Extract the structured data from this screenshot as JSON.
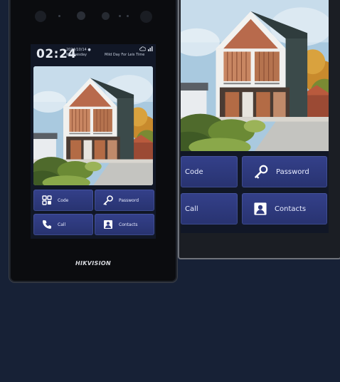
{
  "left_device": {
    "status": {
      "time": "02:24",
      "date_line1": "2024/10/14 ●",
      "date_line2": "Wednesday",
      "message": "Mild Day For Leis Time",
      "icons": [
        "cloud-icon",
        "signal-icon"
      ]
    },
    "buttons": [
      {
        "label": "Code",
        "icon": "keypad-icon"
      },
      {
        "label": "Password",
        "icon": "key-icon"
      },
      {
        "label": "Call",
        "icon": "phone-icon"
      },
      {
        "label": "Contacts",
        "icon": "contact-card-icon"
      }
    ],
    "brand": "HIKVISION"
  },
  "right_device": {
    "buttons": [
      {
        "label": "Code",
        "icon": "keypad-icon"
      },
      {
        "label": "Password",
        "icon": "key-icon"
      },
      {
        "label": "Call",
        "icon": "phone-icon"
      },
      {
        "label": "Contacts",
        "icon": "contact-card-icon"
      }
    ]
  },
  "colors": {
    "background": "#172136",
    "button": "#2f3a80",
    "screen": "#111726"
  }
}
